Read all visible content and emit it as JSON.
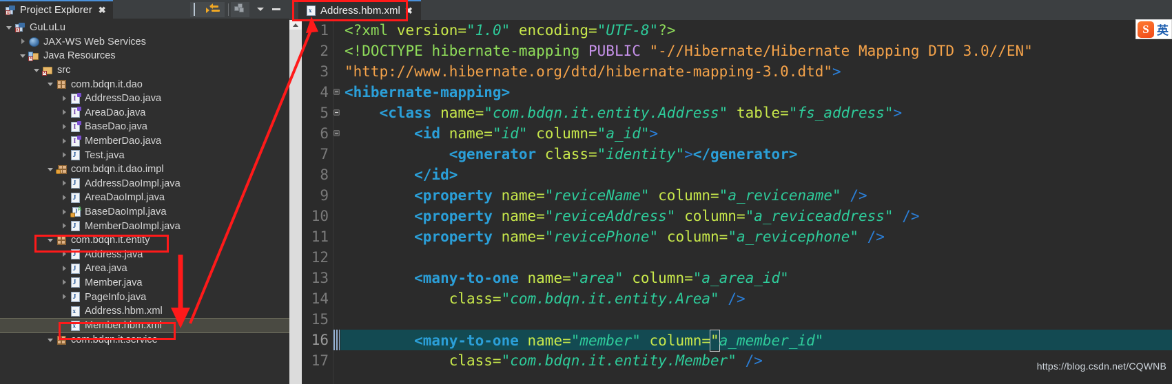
{
  "explorer": {
    "view_tab": {
      "title": "Project Explorer",
      "close_glyph": "✖",
      "icon": "project-explorer-icon"
    },
    "toolbar": [
      {
        "name": "collapse-all-button",
        "tooltip": "Collapse All"
      },
      {
        "name": "link-with-editor-button",
        "tooltip": "Link with Editor"
      },
      {
        "name": "view-menu-cube-button",
        "tooltip": "View Menu"
      },
      {
        "name": "view-menu-button",
        "tooltip": "View Menu"
      },
      {
        "name": "minimize-button",
        "tooltip": "Minimize"
      }
    ],
    "tree": [
      {
        "label": "GuLuLu",
        "depth": 0,
        "twist": "down",
        "icon": "java-project-icon",
        "selected": false
      },
      {
        "label": "JAX-WS Web Services",
        "depth": 1,
        "twist": "right",
        "icon": "web-services-icon",
        "selected": false
      },
      {
        "label": "Java Resources",
        "depth": 1,
        "twist": "down",
        "icon": "java-resources-icon",
        "selected": false
      },
      {
        "label": "src",
        "depth": 2,
        "twist": "down",
        "icon": "source-folder-icon",
        "selected": false
      },
      {
        "label": "com.bdqn.it.dao",
        "depth": 3,
        "twist": "down",
        "icon": "package-icon",
        "selected": false
      },
      {
        "label": "AddressDao.java",
        "depth": 4,
        "twist": "right",
        "icon": "java-interface-icon",
        "selected": false
      },
      {
        "label": "AreaDao.java",
        "depth": 4,
        "twist": "right",
        "icon": "java-interface-icon",
        "selected": false
      },
      {
        "label": "BaseDao.java",
        "depth": 4,
        "twist": "right",
        "icon": "java-interface-icon",
        "selected": false
      },
      {
        "label": "MemberDao.java",
        "depth": 4,
        "twist": "right",
        "icon": "java-interface-icon",
        "selected": false
      },
      {
        "label": "Test.java",
        "depth": 4,
        "twist": "right",
        "icon": "java-file-icon",
        "selected": false
      },
      {
        "label": "com.bdqn.it.dao.impl",
        "depth": 3,
        "twist": "down",
        "icon": "package-lock-icon",
        "selected": false
      },
      {
        "label": "AddressDaoImpl.java",
        "depth": 4,
        "twist": "right",
        "icon": "java-file-icon",
        "selected": false
      },
      {
        "label": "AreaDaoImpl.java",
        "depth": 4,
        "twist": "right",
        "icon": "java-file-icon",
        "selected": false
      },
      {
        "label": "BaseDaoImpl.java",
        "depth": 4,
        "twist": "right",
        "icon": "java-abstract-icon",
        "selected": false
      },
      {
        "label": "MemberDaoImpl.java",
        "depth": 4,
        "twist": "right",
        "icon": "java-file-icon",
        "selected": false
      },
      {
        "label": "com.bdqn.it.entity",
        "depth": 3,
        "twist": "down",
        "icon": "package-icon",
        "selected": false
      },
      {
        "label": "Address.java",
        "depth": 4,
        "twist": "right",
        "icon": "java-file-icon",
        "selected": false
      },
      {
        "label": "Area.java",
        "depth": 4,
        "twist": "right",
        "icon": "java-file-icon",
        "selected": false
      },
      {
        "label": "Member.java",
        "depth": 4,
        "twist": "right",
        "icon": "java-file-icon",
        "selected": false
      },
      {
        "label": "PageInfo.java",
        "depth": 4,
        "twist": "right",
        "icon": "java-file-icon",
        "selected": false
      },
      {
        "label": "Address.hbm.xml",
        "depth": 4,
        "twist": "none",
        "icon": "xml-file-icon",
        "selected": false
      },
      {
        "label": "Member.hbm.xml",
        "depth": 4,
        "twist": "none",
        "icon": "xml-file-icon",
        "selected": true
      },
      {
        "label": "com.bdqn.it.service",
        "depth": 3,
        "twist": "down",
        "icon": "package-icon",
        "selected": false
      }
    ]
  },
  "editor": {
    "tab": {
      "title": "Address.hbm.xml",
      "close_glyph": "✖",
      "icon": "xml-file-icon"
    },
    "current_line": 16,
    "lines": [
      {
        "n": 1,
        "fold": false,
        "tokens": [
          {
            "t": "<?xml ",
            "c": "t-decl"
          },
          {
            "t": "version=",
            "c": "t-attr"
          },
          {
            "t": "\"1.0\"",
            "c": "t-val"
          },
          {
            "t": " ",
            "c": "t-plain"
          },
          {
            "t": "encoding=",
            "c": "t-attr"
          },
          {
            "t": "\"UTF-8\"",
            "c": "t-val"
          },
          {
            "t": "?>",
            "c": "t-decl"
          }
        ]
      },
      {
        "n": 2,
        "fold": false,
        "tokens": [
          {
            "t": "<!DOCTYPE",
            "c": "t-decl"
          },
          {
            "t": " hibernate-mapping ",
            "c": "t-decl"
          },
          {
            "t": "PUBLIC",
            "c": "t-kw"
          },
          {
            "t": " ",
            "c": "t-plain"
          },
          {
            "t": "\"-//Hibernate/Hibernate Mapping DTD 3.0//EN\"",
            "c": "t-dtd"
          }
        ]
      },
      {
        "n": 3,
        "fold": false,
        "tokens": [
          {
            "t": "\"http://www.hibernate.org/dtd/hibernate-mapping-3.0.dtd\"",
            "c": "t-dtd"
          },
          {
            "t": ">",
            "c": "t-punct"
          }
        ]
      },
      {
        "n": 4,
        "fold": true,
        "tokens": [
          {
            "t": "<hibernate-mapping>",
            "c": "t-tag"
          }
        ]
      },
      {
        "n": 5,
        "fold": true,
        "tokens": [
          {
            "t": "    <class",
            "c": "t-tag"
          },
          {
            "t": " name=",
            "c": "t-attr"
          },
          {
            "t": "\"com.bdqn.it.entity.Address\"",
            "c": "t-val"
          },
          {
            "t": " table=",
            "c": "t-attr"
          },
          {
            "t": "\"fs_address\"",
            "c": "t-val"
          },
          {
            "t": ">",
            "c": "t-punct"
          }
        ]
      },
      {
        "n": 6,
        "fold": true,
        "tokens": [
          {
            "t": "        <id",
            "c": "t-tag"
          },
          {
            "t": " name=",
            "c": "t-attr"
          },
          {
            "t": "\"id\"",
            "c": "t-val"
          },
          {
            "t": " column=",
            "c": "t-attr"
          },
          {
            "t": "\"a_id\"",
            "c": "t-val"
          },
          {
            "t": ">",
            "c": "t-punct"
          }
        ]
      },
      {
        "n": 7,
        "fold": false,
        "tokens": [
          {
            "t": "            <generator",
            "c": "t-tag"
          },
          {
            "t": " class=",
            "c": "t-attr"
          },
          {
            "t": "\"identity\"",
            "c": "t-val"
          },
          {
            "t": ">",
            "c": "t-punct"
          },
          {
            "t": "</generator>",
            "c": "t-tag"
          }
        ]
      },
      {
        "n": 8,
        "fold": false,
        "tokens": [
          {
            "t": "        </id>",
            "c": "t-tag"
          }
        ]
      },
      {
        "n": 9,
        "fold": false,
        "tokens": [
          {
            "t": "        <property",
            "c": "t-tag"
          },
          {
            "t": " name=",
            "c": "t-attr"
          },
          {
            "t": "\"reviceName\"",
            "c": "t-val"
          },
          {
            "t": " column=",
            "c": "t-attr"
          },
          {
            "t": "\"a_revicename\"",
            "c": "t-val"
          },
          {
            "t": " ",
            "c": "t-plain"
          },
          {
            "t": "/>",
            "c": "t-punct"
          }
        ]
      },
      {
        "n": 10,
        "fold": false,
        "tokens": [
          {
            "t": "        <property",
            "c": "t-tag"
          },
          {
            "t": " name=",
            "c": "t-attr"
          },
          {
            "t": "\"reviceAddress\"",
            "c": "t-val"
          },
          {
            "t": " column=",
            "c": "t-attr"
          },
          {
            "t": "\"a_reviceaddress\"",
            "c": "t-val"
          },
          {
            "t": " ",
            "c": "t-plain"
          },
          {
            "t": "/>",
            "c": "t-punct"
          }
        ]
      },
      {
        "n": 11,
        "fold": false,
        "tokens": [
          {
            "t": "        <property",
            "c": "t-tag"
          },
          {
            "t": " name=",
            "c": "t-attr"
          },
          {
            "t": "\"revicePhone\"",
            "c": "t-val"
          },
          {
            "t": " column=",
            "c": "t-attr"
          },
          {
            "t": "\"a_revicephone\"",
            "c": "t-val"
          },
          {
            "t": " ",
            "c": "t-plain"
          },
          {
            "t": "/>",
            "c": "t-punct"
          }
        ]
      },
      {
        "n": 12,
        "fold": false,
        "tokens": []
      },
      {
        "n": 13,
        "fold": false,
        "tokens": [
          {
            "t": "        <many-to-one",
            "c": "t-tag"
          },
          {
            "t": " name=",
            "c": "t-attr"
          },
          {
            "t": "\"area\"",
            "c": "t-val"
          },
          {
            "t": " column=",
            "c": "t-attr"
          },
          {
            "t": "\"a_area_id\"",
            "c": "t-val"
          }
        ]
      },
      {
        "n": 14,
        "fold": false,
        "tokens": [
          {
            "t": "            class=",
            "c": "t-attr"
          },
          {
            "t": "\"com.bdqn.it.entity.Area\"",
            "c": "t-val"
          },
          {
            "t": " ",
            "c": "t-plain"
          },
          {
            "t": "/>",
            "c": "t-punct"
          }
        ]
      },
      {
        "n": 15,
        "fold": false,
        "tokens": []
      },
      {
        "n": 16,
        "fold": false,
        "current": true,
        "tokens": [
          {
            "t": "        <many-to-one",
            "c": "t-tag"
          },
          {
            "t": " name=",
            "c": "t-attr"
          },
          {
            "t": "\"member\"",
            "c": "t-val"
          },
          {
            "t": " column=",
            "c": "t-attr"
          },
          {
            "t": "\"",
            "c": "t-attr",
            "box": true
          },
          {
            "t": "a_member_id\"",
            "c": "t-val"
          }
        ]
      },
      {
        "n": 17,
        "fold": false,
        "tokens": [
          {
            "t": "            class=",
            "c": "t-attr"
          },
          {
            "t": "\"com.bdqn.it.entity.Member\"",
            "c": "t-val"
          },
          {
            "t": " ",
            "c": "t-plain"
          },
          {
            "t": "/>",
            "c": "t-punct"
          }
        ]
      }
    ]
  },
  "overlays": {
    "watermark": "https://blog.csdn.net/CQWNB",
    "ime": {
      "logo_letter": "S",
      "label": "英"
    },
    "annotation_color": "#ff1a1a"
  }
}
